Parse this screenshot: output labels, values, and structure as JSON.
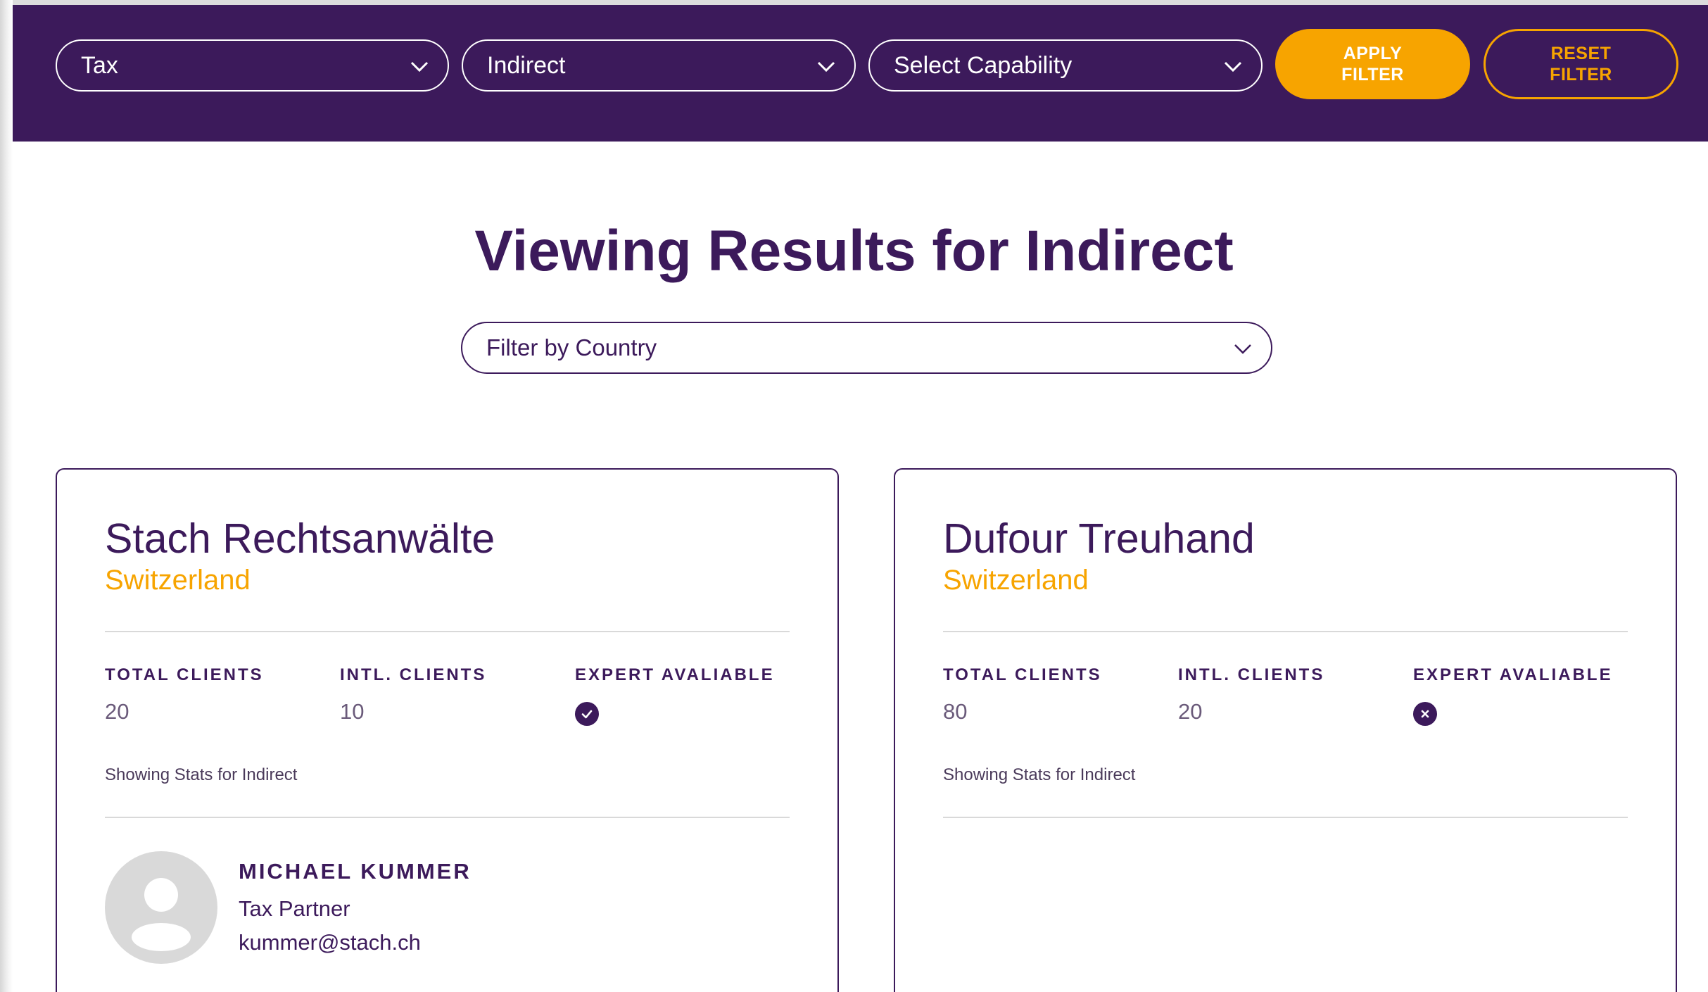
{
  "filters": {
    "service": "Tax",
    "sub_service": "Indirect",
    "capability": "Select Capability",
    "apply_label": "APPLY\nFILTER",
    "reset_label": "RESET\nFILTER"
  },
  "results": {
    "title": "Viewing Results for Indirect",
    "country_filter": "Filter by Country"
  },
  "labels": {
    "total_clients": "TOTAL CLIENTS",
    "intl_clients": "INTL. CLIENTS",
    "expert_available": "EXPERT AVALIABLE"
  },
  "colors": {
    "brand_purple": "#3c1a5b",
    "accent_orange": "#f7a400"
  },
  "firms": [
    {
      "name": "Stach Rechtsanwälte",
      "country": "Switzerland",
      "total_clients": "20",
      "intl_clients": "10",
      "expert_available": "check-icon",
      "stats_note": "Showing Stats for Indirect",
      "contact": {
        "name": "MICHAEL KUMMER",
        "role": "Tax Partner",
        "email": "kummer@stach.ch"
      }
    },
    {
      "name": "Dufour Treuhand",
      "country": "Switzerland",
      "total_clients": "80",
      "intl_clients": "20",
      "expert_available": "x-icon",
      "stats_note": "Showing Stats for Indirect"
    }
  ]
}
